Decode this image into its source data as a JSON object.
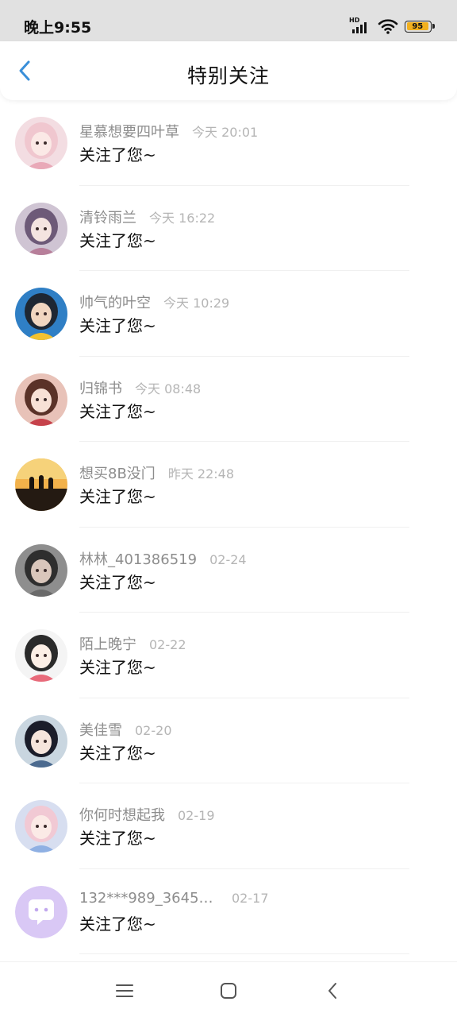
{
  "status_bar": {
    "time": "晚上9:55",
    "network_label": "HD",
    "battery_level": "95",
    "battery_color": "#f2b01e"
  },
  "header": {
    "title": "特别关注",
    "back_icon": "chevron-left-icon",
    "accent_color": "#3a8fd9"
  },
  "notifications": [
    {
      "name": "星慕想要四叶草",
      "time": "今天 20:01",
      "message": "关注了您~",
      "avatar": "avatar-girl-pink"
    },
    {
      "name": "清铃雨兰",
      "time": "今天 16:22",
      "message": "关注了您~",
      "avatar": "avatar-girl-fan"
    },
    {
      "name": "帅气的叶空",
      "time": "今天 10:29",
      "message": "关注了您~",
      "avatar": "avatar-boy-cap"
    },
    {
      "name": "归锦书",
      "time": "今天 08:48",
      "message": "关注了您~",
      "avatar": "avatar-girl-red"
    },
    {
      "name": "想买8B没门",
      "time": "昨天 22:48",
      "message": "关注了您~",
      "avatar": "avatar-sunset"
    },
    {
      "name": "林林_401386519",
      "time": "02-24",
      "message": "关注了您~",
      "avatar": "avatar-photo-gray"
    },
    {
      "name": "陌上晚宁",
      "time": "02-22",
      "message": "关注了您~",
      "avatar": "avatar-chibi"
    },
    {
      "name": "美佳雪",
      "time": "02-20",
      "message": "关注了您~",
      "avatar": "avatar-girl-dark"
    },
    {
      "name": "你何时想起我",
      "time": "02-19",
      "message": "关注了您~",
      "avatar": "avatar-girl-blue"
    },
    {
      "name": "132***989_36457...",
      "time": "02-17",
      "message": "关注了您~",
      "avatar": "avatar-default-chat"
    }
  ],
  "system_nav": {
    "menu_icon": "menu-icon",
    "home_icon": "home-icon",
    "back_icon": "back-icon"
  }
}
